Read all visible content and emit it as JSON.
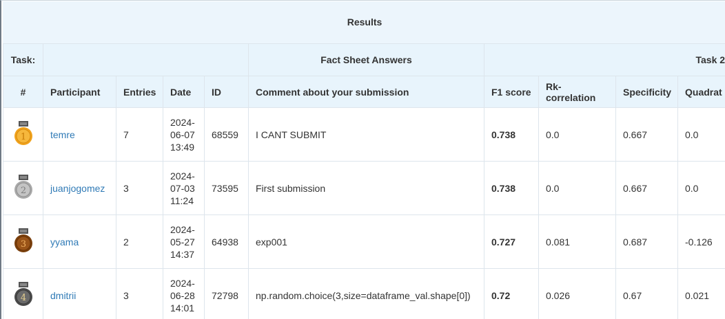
{
  "title": "Results",
  "header_row1": {
    "task_label": "Task:",
    "fact_sheet": "Fact Sheet Answers",
    "task2": "Task 2"
  },
  "columns": [
    "#",
    "Participant",
    "Entries",
    "Date",
    "ID",
    "Comment about your submission",
    "F1 score",
    "Rk-correlation",
    "Specificity",
    "Quadrat"
  ],
  "rows": [
    {
      "medal": "gold-medal-icon",
      "rank": "1",
      "participant": "temre",
      "entries": "7",
      "date": [
        "2024-",
        "06-07",
        "13:49"
      ],
      "id": "68559",
      "comment": "I CANT SUBMIT",
      "f1": "0.738",
      "rk": "0.0",
      "spec": "0.667",
      "quad": "0.0"
    },
    {
      "medal": "silver-medal-icon",
      "rank": "2",
      "participant": "juanjogomez",
      "entries": "3",
      "date": [
        "2024-",
        "07-03",
        "11:24"
      ],
      "id": "73595",
      "comment": "First submission",
      "f1": "0.738",
      "rk": "0.0",
      "spec": "0.667",
      "quad": "0.0"
    },
    {
      "medal": "bronze-medal-icon",
      "rank": "3",
      "participant": "yyama",
      "entries": "2",
      "date": [
        "2024-",
        "05-27",
        "14:37"
      ],
      "id": "64938",
      "comment": "exp001",
      "f1": "0.727",
      "rk": "0.081",
      "spec": "0.687",
      "quad": "-0.126"
    },
    {
      "medal": "fourth-medal-icon",
      "rank": "4",
      "participant": "dmitrii",
      "entries": "3",
      "date": [
        "2024-",
        "06-28",
        "14:01"
      ],
      "id": "72798",
      "comment": "np.random.choice(3,size=dataframe_val.shape[0])",
      "f1": "0.72",
      "rk": "0.026",
      "spec": "0.67",
      "quad": "0.021"
    }
  ],
  "colors": {
    "gold": "#f0a21c",
    "silver": "#a9a9a9",
    "bronze": "#8a4c12",
    "fourth": "#5a5a5a",
    "link": "#2f7ab6",
    "header_bg": "#e8f4fc"
  }
}
